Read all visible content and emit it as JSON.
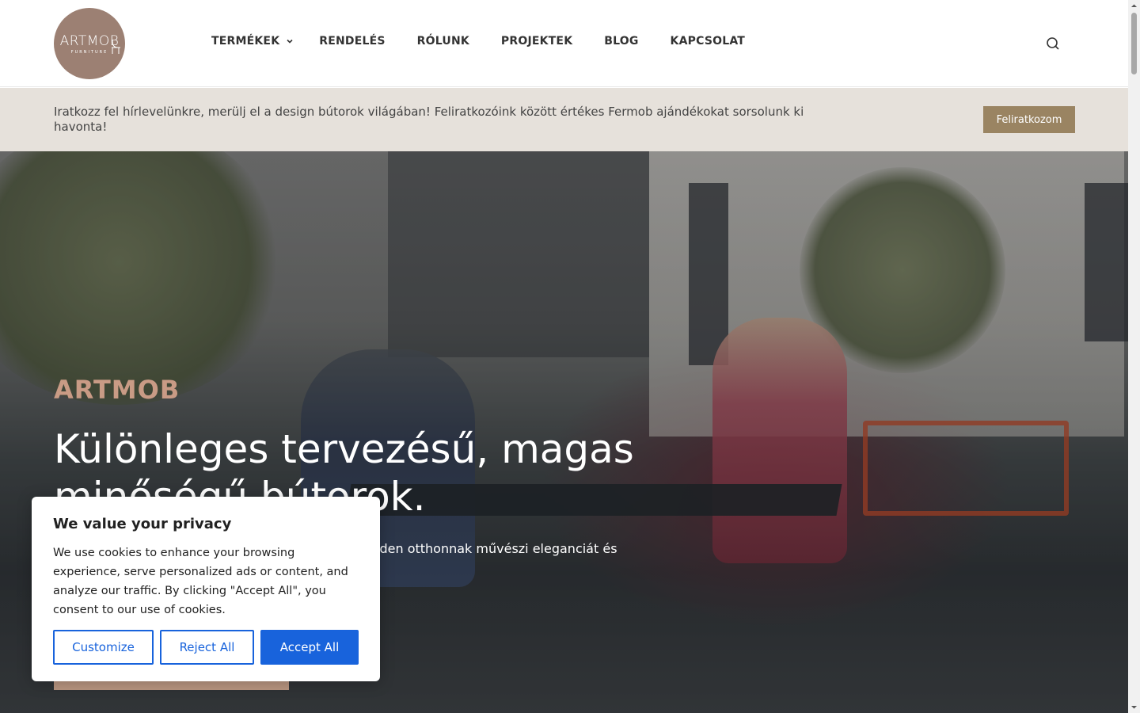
{
  "header": {
    "logo": {
      "main": "ARTMOB",
      "sub": "FURNITURE"
    },
    "nav": [
      {
        "label": "TERMÉKEK",
        "has_dropdown": true
      },
      {
        "label": "RENDELÉS"
      },
      {
        "label": "RÓLUNK"
      },
      {
        "label": "PROJEKTEK"
      },
      {
        "label": "BLOG"
      },
      {
        "label": "KAPCSOLAT"
      }
    ],
    "search_icon": "search-icon"
  },
  "newsletter": {
    "text": "Iratkozz fel hírlevelünkre, merülj el a design bútorok világában! Feliratkozóink között értékes Fermob ajándékokat sorsolunk ki havonta!",
    "button": "Feliratkozom",
    "button_color": "#9a8462",
    "bg_color": "#e6e1db"
  },
  "hero": {
    "brand": "ARTMOB",
    "brand_color": "#c99b85",
    "title": "Különleges tervezésű, magas minőségű bútorok.",
    "description": "Ha egyedi enteriőrök kialakítása a célod, akkor minden otthonnak művészi eleganciát és"
  },
  "cookie": {
    "title": "We value your privacy",
    "text": "We use cookies to enhance your browsing experience, serve personalized ads or content, and analyze our traffic. By clicking \"Accept All\", you consent to our use of cookies.",
    "buttons": {
      "customize": "Customize",
      "reject": "Reject All",
      "accept": "Accept All"
    },
    "accent_color": "#1863dc"
  }
}
